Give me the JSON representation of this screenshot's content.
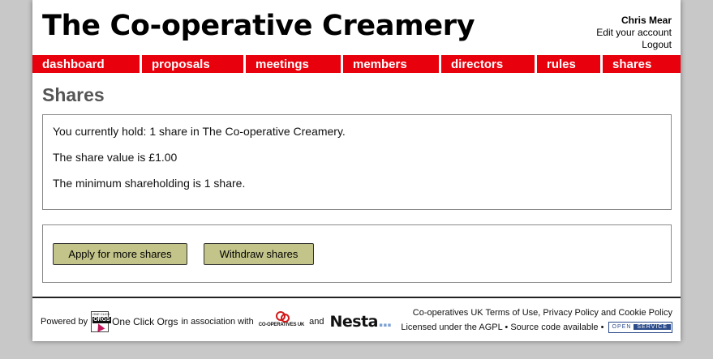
{
  "header": {
    "org_title": "The Co-operative Creamery",
    "user": {
      "name": "Chris Mear",
      "edit_account": "Edit your account",
      "logout": "Logout"
    }
  },
  "nav": {
    "tabs": [
      {
        "label": "dashboard"
      },
      {
        "label": "proposals"
      },
      {
        "label": "meetings"
      },
      {
        "label": "members"
      },
      {
        "label": "directors"
      },
      {
        "label": "rules"
      },
      {
        "label": "shares"
      }
    ]
  },
  "main": {
    "heading": "Shares",
    "info": {
      "holding": "You currently hold: 1 share in The Co-operative Creamery.",
      "share_value": "The share value is £1.00",
      "minimum": "The minimum shareholding is 1 share."
    },
    "actions": {
      "apply_label": "Apply for more shares",
      "withdraw_label": "Withdraw shares"
    }
  },
  "footer": {
    "powered_by": "Powered by",
    "oco_logo_text_top": "ONE CLICK",
    "oco_logo_text_main": "ORGS",
    "oco_name": "One Click Orgs",
    "association_text": "in association with",
    "coop_logo_text": "CO-OPERATIVES UK",
    "and_text": "and",
    "nesta_text": "Nesta",
    "nesta_dots": "...",
    "terms_prefix": "Co-operatives UK",
    "terms_link": "Terms of Use",
    "terms_sep1": ",",
    "privacy_link": "Privacy Policy",
    "terms_and": "and",
    "cookie_link": "Cookie Policy",
    "license_text": "Licensed under the",
    "agpl_link": "AGPL",
    "bullet": "•",
    "source_link": "Source code available",
    "open_service_open": "OPEN",
    "open_service_service": "SERVICE"
  },
  "colors": {
    "nav_red": "#e8000c",
    "button_olive": "#c3c48a",
    "heading_gray": "#555555",
    "open_service_blue": "#2a4a8a"
  }
}
